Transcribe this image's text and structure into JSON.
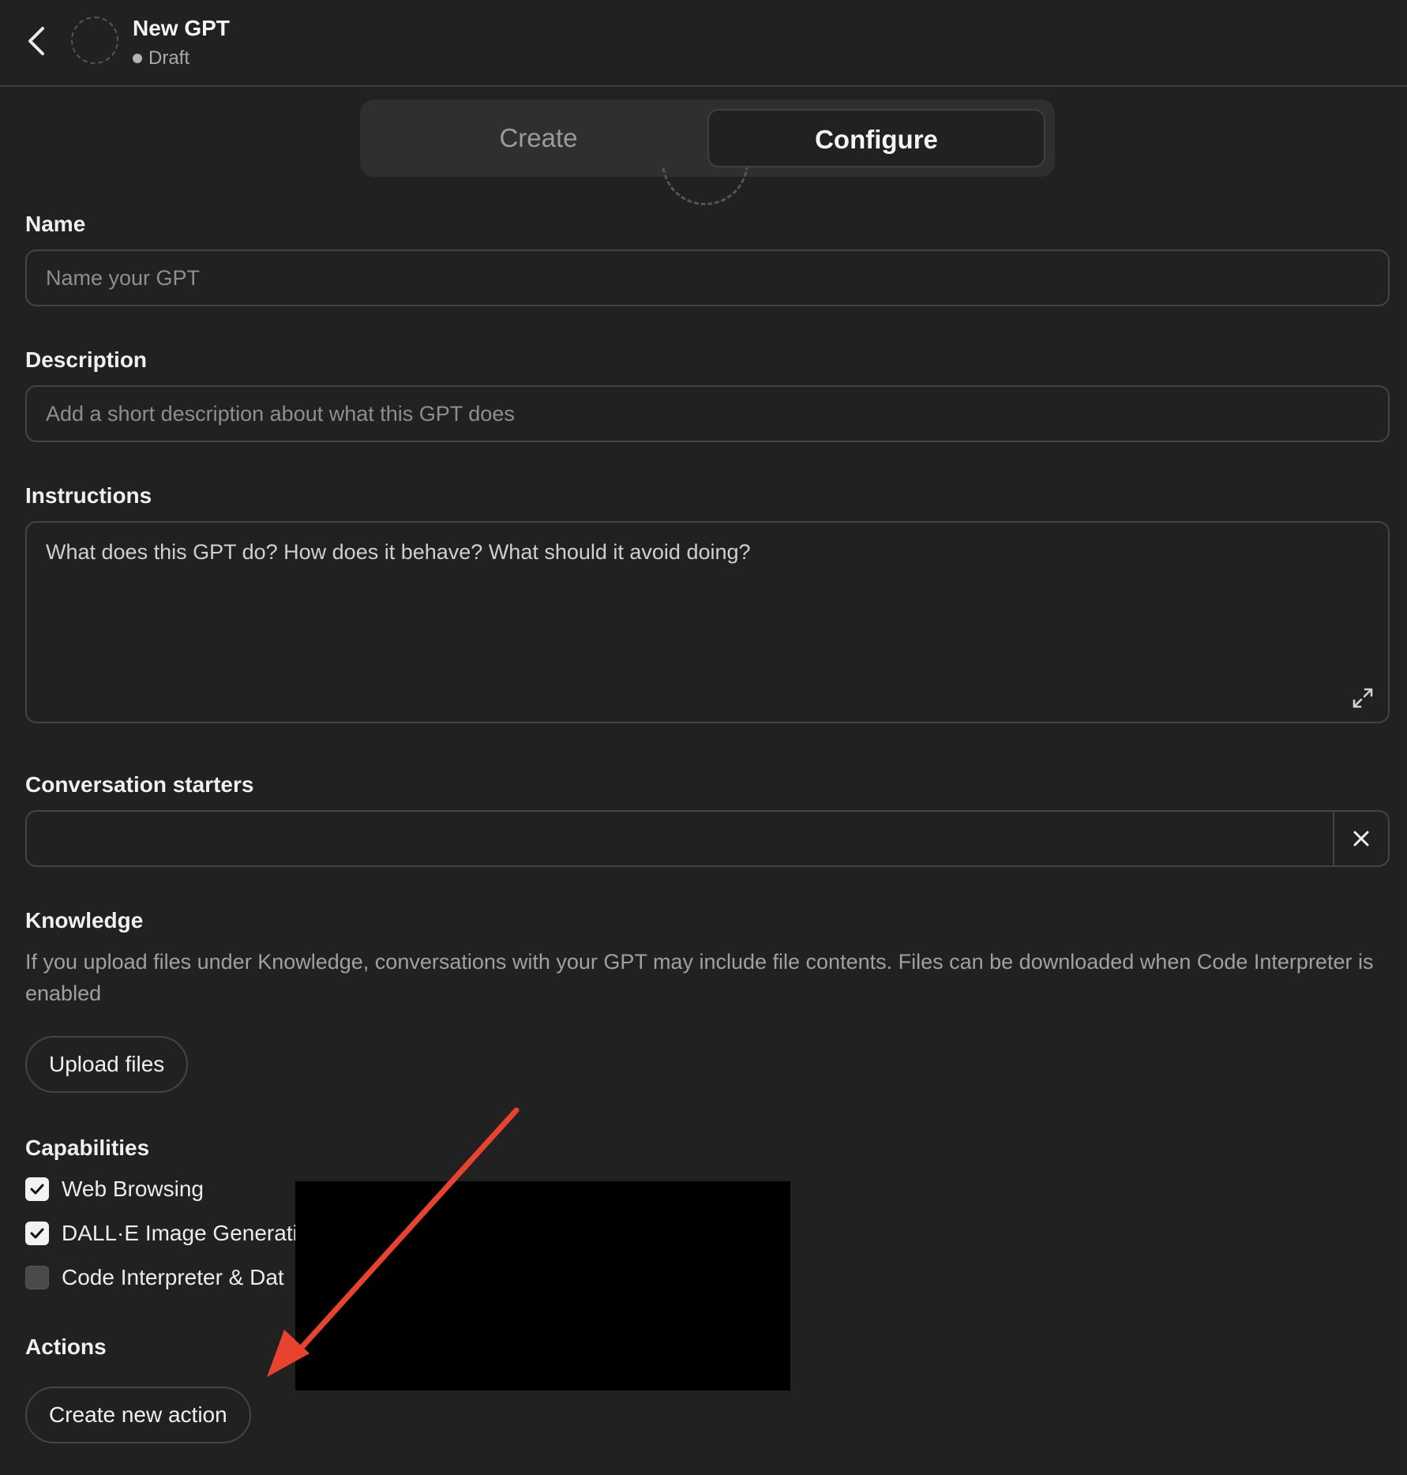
{
  "header": {
    "back_icon": "chevron-left-icon",
    "title": "New GPT",
    "status": "Draft"
  },
  "tabs": [
    {
      "label": "Create",
      "active": false
    },
    {
      "label": "Configure",
      "active": true
    }
  ],
  "form": {
    "name": {
      "label": "Name",
      "placeholder": "Name your GPT",
      "value": ""
    },
    "description": {
      "label": "Description",
      "placeholder": "Add a short description about what this GPT does",
      "value": ""
    },
    "instructions": {
      "label": "Instructions",
      "placeholder": "What does this GPT do? How does it behave? What should it avoid doing?",
      "value": "",
      "expand_icon": "expand-icon"
    },
    "conversation_starters": {
      "label": "Conversation starters",
      "value": "",
      "remove_icon": "close-icon"
    },
    "knowledge": {
      "label": "Knowledge",
      "help_text": "If you upload files under Knowledge, conversations with your GPT may include file contents. Files can be downloaded when Code Interpreter is enabled",
      "upload_button": "Upload files"
    },
    "capabilities": {
      "label": "Capabilities",
      "items": [
        {
          "label": "Web Browsing",
          "checked": true
        },
        {
          "label": "DALL·E Image Generati",
          "checked": true
        },
        {
          "label": "Code Interpreter & Dat",
          "checked": false
        }
      ]
    },
    "actions": {
      "label": "Actions",
      "create_button": "Create new action"
    }
  },
  "annotations": {
    "arrow_color": "#e8432f",
    "redaction_color": "#000000"
  }
}
